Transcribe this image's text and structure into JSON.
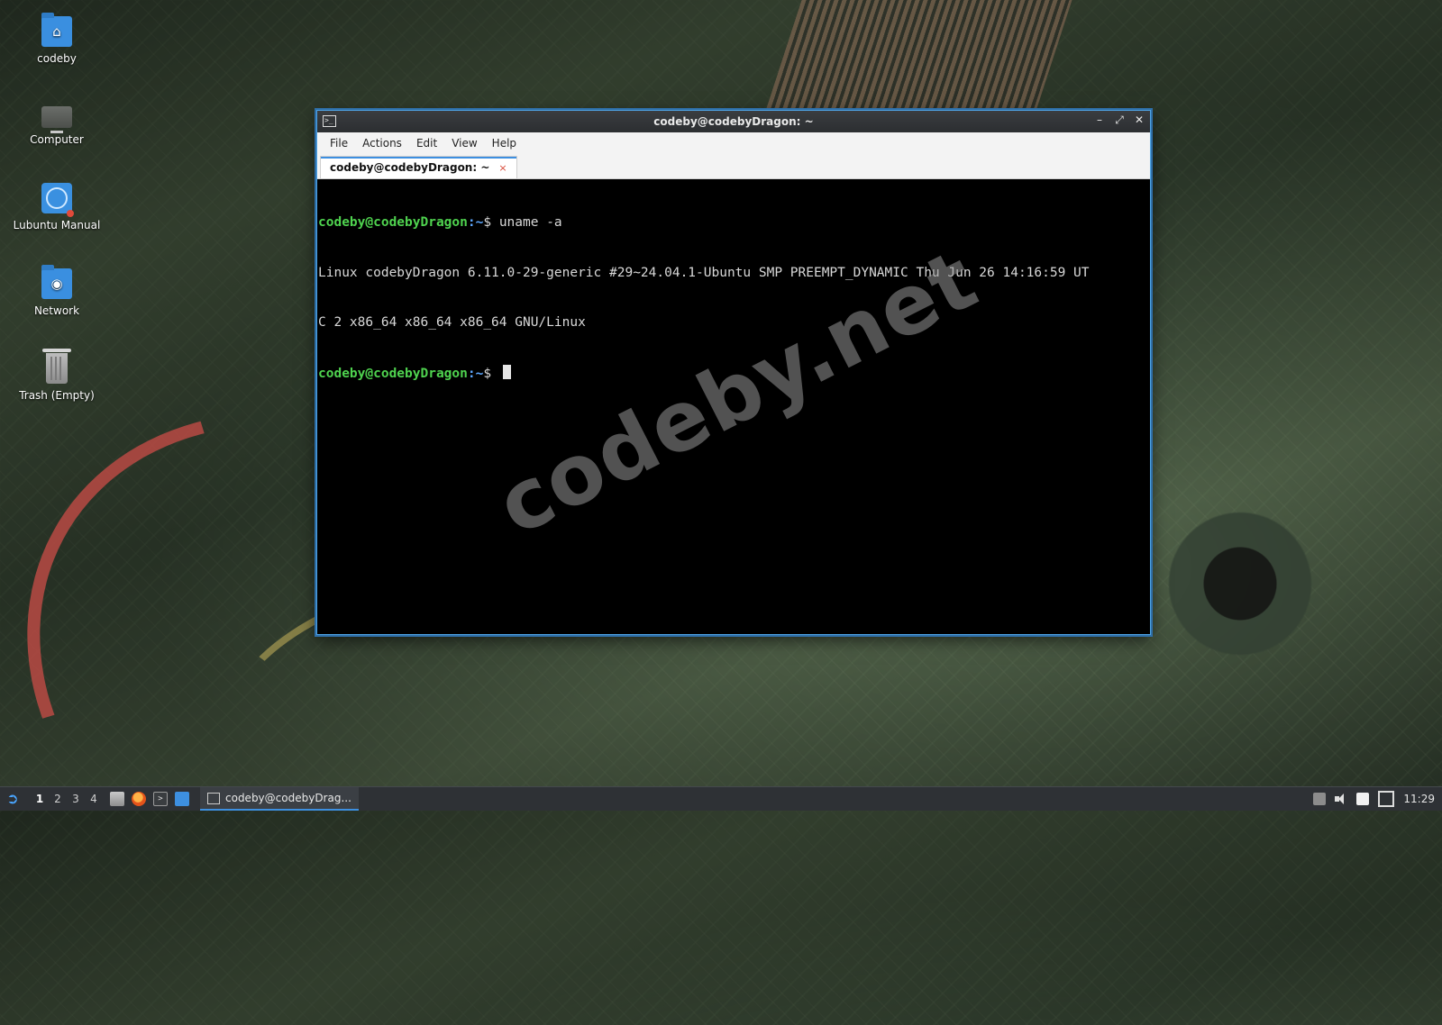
{
  "desktop": {
    "icons": [
      {
        "label": "codeby",
        "icon": "home-folder-icon"
      },
      {
        "label": "Computer",
        "icon": "computer-icon"
      },
      {
        "label": "Lubuntu Manual",
        "icon": "manual-icon"
      },
      {
        "label": "Network",
        "icon": "network-folder-icon"
      },
      {
        "label": "Trash (Empty)",
        "icon": "trash-icon"
      }
    ],
    "watermark": "codeby.net"
  },
  "window": {
    "title": "codeby@codebyDragon: ~",
    "app_icon": ">_",
    "controls": {
      "minimize": "–",
      "maximize": "⤢",
      "close": "✕"
    },
    "menu": [
      "File",
      "Actions",
      "Edit",
      "View",
      "Help"
    ],
    "tab": {
      "label": "codeby@codebyDragon: ~",
      "close": "×"
    }
  },
  "terminal": {
    "line1": {
      "user": "codeby@codebyDragon",
      "path": ":~",
      "prompt": "$ ",
      "command": "uname -a"
    },
    "line2": "Linux codebyDragon 6.11.0-29-generic #29~24.04.1-Ubuntu SMP PREEMPT_DYNAMIC Thu Jun 26 14:16:59 UT",
    "line3": "C 2 x86_64 x86_64 x86_64 GNU/Linux",
    "line4": {
      "user": "codeby@codebyDragon",
      "path": ":~",
      "prompt": "$ "
    }
  },
  "taskbar": {
    "start_icon": "lubuntu-start-icon",
    "desktops": [
      "1",
      "2",
      "3",
      "4"
    ],
    "active_desktop": "1",
    "quicklaunch": [
      "file-manager-icon",
      "firefox-icon",
      "terminal-icon",
      "show-desktop-icon"
    ],
    "task_label": "codeby@codebyDrag...",
    "clock": "11:29"
  },
  "colors": {
    "accent": "#3d8fe0",
    "prompt_user": "#4fd34f",
    "prompt_path": "#5ea8ff"
  }
}
